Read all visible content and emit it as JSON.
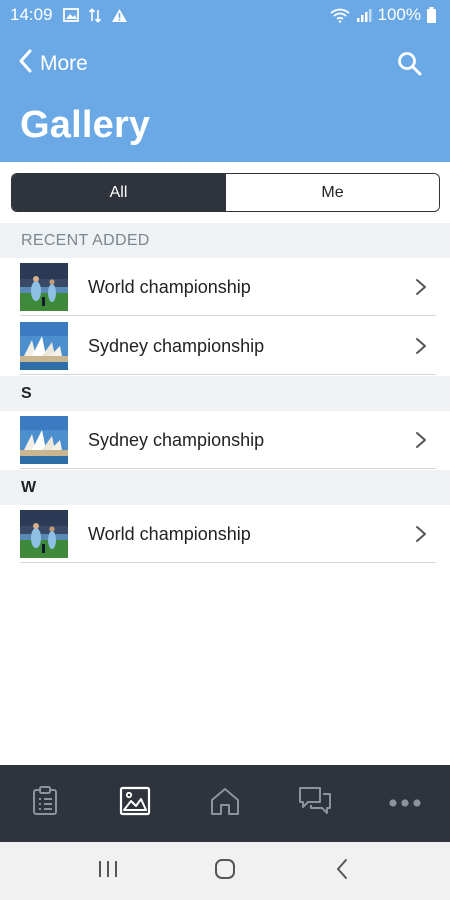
{
  "status_bar": {
    "time": "14:09",
    "battery": "100%"
  },
  "header": {
    "back_label": "More",
    "title": "Gallery"
  },
  "segments": [
    {
      "label": "All",
      "active": true
    },
    {
      "label": "Me",
      "active": false
    }
  ],
  "sections": {
    "recent": "RECENT ADDED",
    "s": "S",
    "w": "W"
  },
  "rows": {
    "recent": [
      {
        "label": "World championship",
        "thumb": "football-photo"
      },
      {
        "label": "Sydney championship",
        "thumb": "opera-house-photo"
      }
    ],
    "s": [
      {
        "label": "Sydney championship",
        "thumb": "opera-house-photo"
      }
    ],
    "w": [
      {
        "label": "World championship",
        "thumb": "football-photo"
      }
    ]
  },
  "bottom_nav": [
    {
      "icon": "clipboard-icon",
      "active": false
    },
    {
      "icon": "image-icon",
      "active": true
    },
    {
      "icon": "home-icon",
      "active": false
    },
    {
      "icon": "chat-icon",
      "active": false
    },
    {
      "icon": "more-dots-icon",
      "active": false
    }
  ],
  "colors": {
    "header_bg": "#6aa9e6",
    "dark": "#2f343c",
    "section_bg": "#eff2f4"
  }
}
